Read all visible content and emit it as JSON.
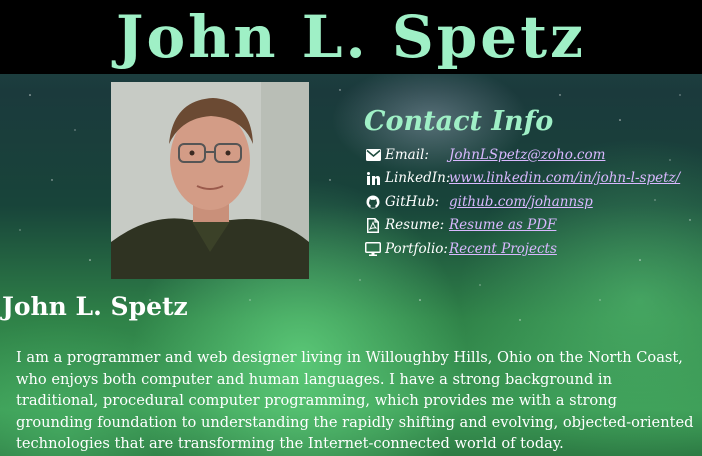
{
  "header": {
    "title": "John L. Spetz"
  },
  "photo": {
    "alt": "Portrait of John L. Spetz"
  },
  "contact": {
    "title": "Contact Info",
    "items": [
      {
        "icon": "envelope-icon",
        "label": "Email:",
        "link": "JohnLSpetz@zoho.com"
      },
      {
        "icon": "linkedin-icon",
        "label": "LinkedIn:",
        "link": "www.linkedin.com/in/john-l-spetz/"
      },
      {
        "icon": "github-icon",
        "label": "GitHub:",
        "link": "github.com/johannsp"
      },
      {
        "icon": "pdf-file-icon",
        "label": "Resume:",
        "link": "Resume as PDF"
      },
      {
        "icon": "monitor-icon",
        "label": "Portfolio:",
        "link": "Recent Projects"
      }
    ]
  },
  "about": {
    "heading": "John L. Spetz",
    "bio": "I am a programmer and web designer living in Willoughby Hills, Ohio on the North Coast, who enjoys both computer and human languages. I have a strong background in traditional, procedural computer programming, which provides me with a strong grounding foundation to understanding the rapidly shifting and evolving, objected-oriented technologies that are transforming the Internet-connected world of today."
  },
  "colors": {
    "title": "#9ff0c6",
    "link": "#d9b8ff",
    "header_bg": "#000000"
  }
}
